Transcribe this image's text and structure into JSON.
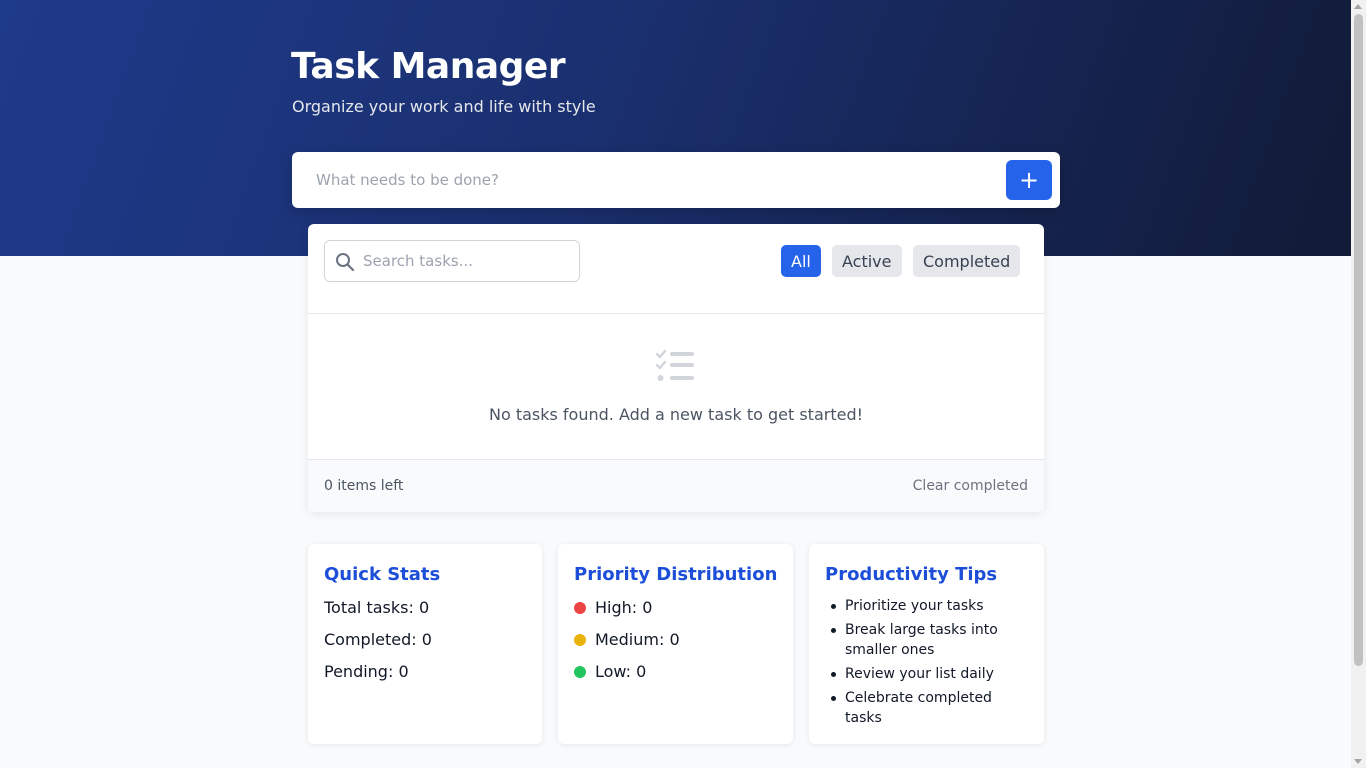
{
  "header": {
    "title": "Task Manager",
    "subtitle": "Organize your work and life with style"
  },
  "add_task": {
    "placeholder": "What needs to be done?",
    "button_label": "+"
  },
  "search": {
    "placeholder": "Search tasks...",
    "icon": "search-icon"
  },
  "filters": [
    {
      "label": "All",
      "active": true
    },
    {
      "label": "Active",
      "active": false
    },
    {
      "label": "Completed",
      "active": false
    }
  ],
  "empty_state": {
    "icon": "tasks-list-icon",
    "message": "No tasks found. Add a new task to get started!"
  },
  "footer": {
    "items_left": "0 items left",
    "clear_label": "Clear completed"
  },
  "quick_stats": {
    "title": "Quick Stats",
    "total": "Total tasks: 0",
    "completed": "Completed: 0",
    "pending": "Pending: 0"
  },
  "priority": {
    "title": "Priority Distribution",
    "high": "High: 0",
    "medium": "Medium: 0",
    "low": "Low: 0",
    "colors": {
      "high": "#ef4444",
      "medium": "#eab308",
      "low": "#22c55e"
    }
  },
  "tips": {
    "title": "Productivity Tips",
    "items": [
      "Prioritize your tasks",
      "Break large tasks into smaller ones",
      "Review your list daily",
      "Celebrate completed tasks"
    ]
  },
  "colors": {
    "accent": "#2563eb",
    "header_bg_start": "#1e3a8a",
    "header_bg_end": "#111a36"
  }
}
